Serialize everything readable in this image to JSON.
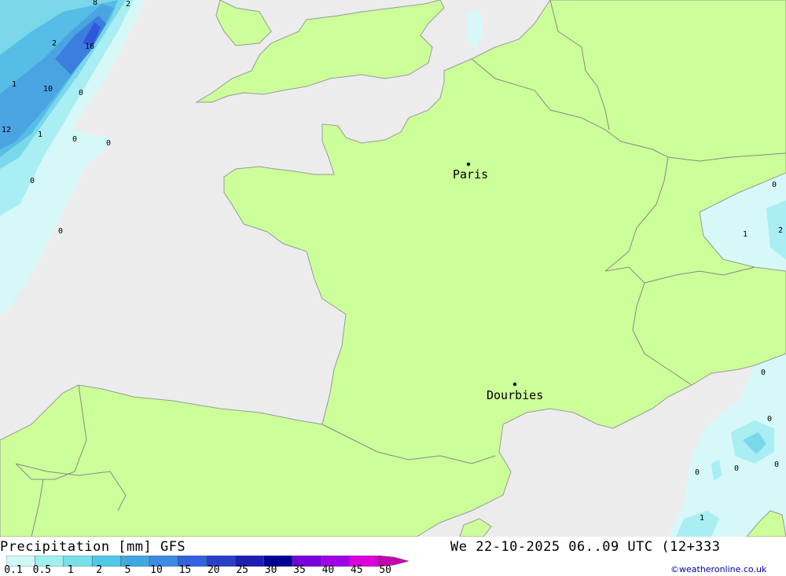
{
  "map": {
    "colors": {
      "sea": "#ececec",
      "land": "#ccff99",
      "border": "#888888",
      "coast": "#999999"
    },
    "cities": [
      {
        "name": "Paris"
      },
      {
        "name": "Dourbies"
      }
    ],
    "contour_labels": [
      "8",
      "2",
      "2",
      "16",
      "1",
      "10",
      "0",
      "12",
      "1",
      "0",
      "0",
      "0",
      "0",
      "0",
      "1",
      "2",
      "0",
      "0",
      "0",
      "0",
      "0",
      "1"
    ]
  },
  "footer": {
    "title": "Precipitation [mm] GFS",
    "datetime": "We 22-10-2025 06..09 UTC (12+333",
    "credit": "©weatheronline.co.uk",
    "legend": {
      "labels": [
        "0.1",
        "0.5",
        "1",
        "2",
        "5",
        "10",
        "15",
        "20",
        "25",
        "30",
        "35",
        "40",
        "45",
        "50"
      ],
      "colors": [
        "#d0f8f8",
        "#a0f0f0",
        "#78e0e8",
        "#50c8e8",
        "#40a8e0",
        "#3c8ce0",
        "#3264e0",
        "#2840c8",
        "#1e1eb4",
        "#000096",
        "#7800dc",
        "#a000e6",
        "#dc00dc",
        "#c800b4"
      ]
    }
  }
}
